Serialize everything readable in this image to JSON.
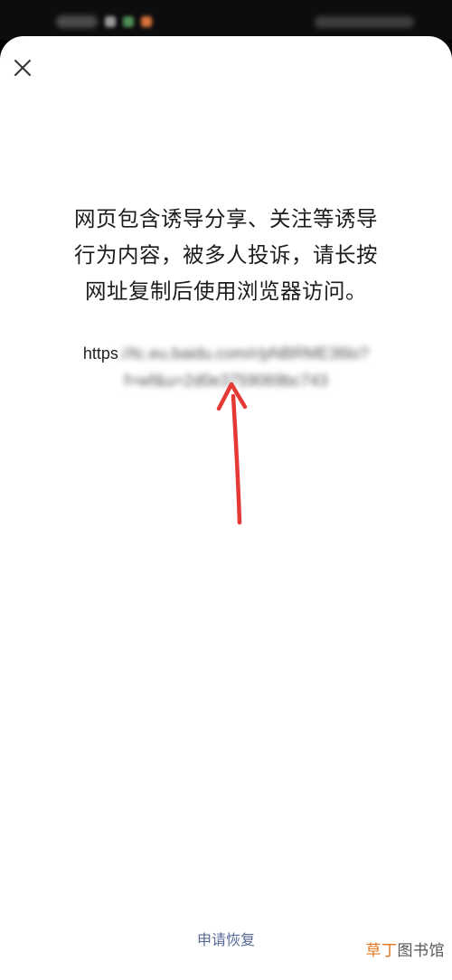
{
  "dialog": {
    "close_icon": "close-icon",
    "message": "网页包含诱导分享、关注等诱导\n行为内容，被多人投诉，请长按\n网址复制后使用浏览器访问。",
    "link": {
      "prefix": "https",
      "blurred_text": "://tc.eu.baidu.com/r/pNBRME36lo?f=wf&u=2d0e3759069bc743"
    },
    "restore_label": "申请恢复"
  },
  "watermark": {
    "part_a": "草丁",
    "part_b": "图书馆"
  },
  "colors": {
    "link_action": "#576b95",
    "annotation_arrow": "#e53935"
  }
}
